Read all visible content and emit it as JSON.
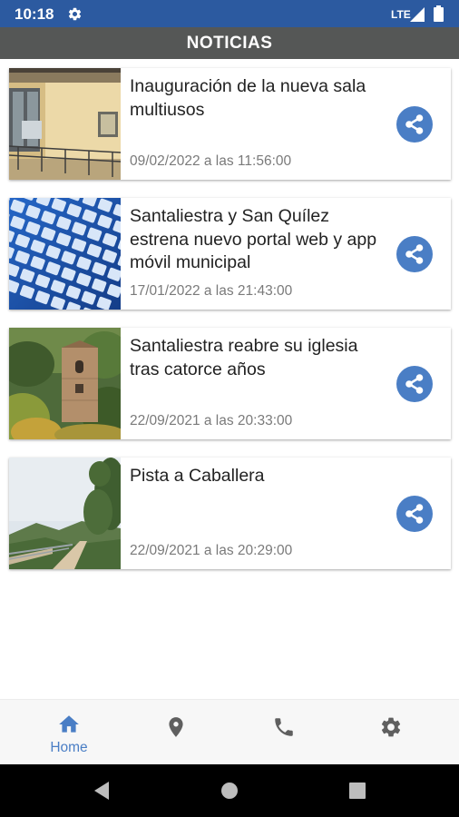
{
  "status_bar": {
    "time": "10:18",
    "network": "LTE",
    "icons": [
      "gear-icon",
      "signal-icon",
      "battery-icon"
    ]
  },
  "header": {
    "title": "NOTICIAS"
  },
  "news": [
    {
      "title": "Inauguración de la nueva sala multiusos",
      "date": "09/02/2022 a las 11:56:00",
      "thumbnail": "building-photo"
    },
    {
      "title": "Santaliestra y San Quílez estrena nuevo portal web y app móvil municipal",
      "date": "17/01/2022 a las 21:43:00",
      "thumbnail": "keyboard-photo"
    },
    {
      "title": "Santaliestra reabre su iglesia tras catorce años",
      "date": "22/09/2021 a las 20:33:00",
      "thumbnail": "church-tower-photo"
    },
    {
      "title": "Pista a Caballera",
      "date": "22/09/2021 a las 20:29:00",
      "thumbnail": "mountain-road-photo"
    }
  ],
  "bottom_nav": {
    "items": [
      {
        "icon": "home-icon",
        "label": "Home",
        "active": true
      },
      {
        "icon": "location-pin-icon",
        "label": ""
      },
      {
        "icon": "phone-icon",
        "label": ""
      },
      {
        "icon": "settings-icon",
        "label": ""
      }
    ]
  },
  "colors": {
    "status_bar": "#2c5aa0",
    "header": "#555756",
    "accent": "#4a7ec5",
    "nav_inactive": "#5f5f5f"
  }
}
